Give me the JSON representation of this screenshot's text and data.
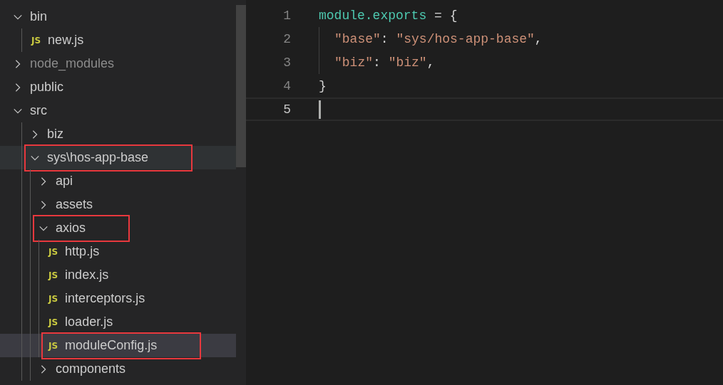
{
  "explorer": {
    "tree": [
      {
        "kind": "folder",
        "label": "bin",
        "expanded": true,
        "dimmed": false,
        "selected": false,
        "hovered": false,
        "highlighted": false,
        "children": [
          {
            "kind": "file",
            "icon": "JS",
            "label": "new.js",
            "dimmed": false,
            "selected": false,
            "hovered": false,
            "highlighted": false
          }
        ]
      },
      {
        "kind": "folder",
        "label": "node_modules",
        "expanded": false,
        "dimmed": true,
        "selected": false,
        "hovered": false,
        "highlighted": false
      },
      {
        "kind": "folder",
        "label": "public",
        "expanded": false,
        "dimmed": false,
        "selected": false,
        "hovered": false,
        "highlighted": false
      },
      {
        "kind": "folder",
        "label": "src",
        "expanded": true,
        "dimmed": false,
        "selected": false,
        "hovered": false,
        "highlighted": false,
        "children": [
          {
            "kind": "folder",
            "label": "biz",
            "expanded": false,
            "dimmed": false,
            "selected": false,
            "hovered": false,
            "highlighted": false
          },
          {
            "kind": "folder",
            "label": "sys\\hos-app-base",
            "expanded": true,
            "dimmed": false,
            "selected": false,
            "hovered": true,
            "highlighted": true,
            "children": [
              {
                "kind": "folder",
                "label": "api",
                "expanded": false,
                "dimmed": false,
                "selected": false,
                "hovered": false,
                "highlighted": false
              },
              {
                "kind": "folder",
                "label": "assets",
                "expanded": false,
                "dimmed": false,
                "selected": false,
                "hovered": false,
                "highlighted": false
              },
              {
                "kind": "folder",
                "label": "axios",
                "expanded": true,
                "dimmed": false,
                "selected": false,
                "hovered": false,
                "highlighted": true,
                "children": [
                  {
                    "kind": "file",
                    "icon": "JS",
                    "label": "http.js",
                    "dimmed": false,
                    "selected": false,
                    "hovered": false,
                    "highlighted": false
                  },
                  {
                    "kind": "file",
                    "icon": "JS",
                    "label": "index.js",
                    "dimmed": false,
                    "selected": false,
                    "hovered": false,
                    "highlighted": false
                  },
                  {
                    "kind": "file",
                    "icon": "JS",
                    "label": "interceptors.js",
                    "dimmed": false,
                    "selected": false,
                    "hovered": false,
                    "highlighted": false
                  },
                  {
                    "kind": "file",
                    "icon": "JS",
                    "label": "loader.js",
                    "dimmed": false,
                    "selected": false,
                    "hovered": false,
                    "highlighted": false
                  },
                  {
                    "kind": "file",
                    "icon": "JS",
                    "label": "moduleConfig.js",
                    "dimmed": false,
                    "selected": true,
                    "hovered": false,
                    "highlighted": true
                  }
                ]
              },
              {
                "kind": "folder",
                "label": "components",
                "expanded": false,
                "dimmed": false,
                "selected": false,
                "hovered": false,
                "highlighted": false
              }
            ]
          }
        ]
      }
    ]
  },
  "editor": {
    "lines": [
      {
        "number": "1",
        "current": false,
        "indented": false,
        "tokens": [
          {
            "kind": "type",
            "text": "module.exports"
          },
          {
            "kind": "plain",
            "text": " = {"
          }
        ]
      },
      {
        "number": "2",
        "current": false,
        "indented": true,
        "tokens": [
          {
            "kind": "string",
            "text": "\"base\""
          },
          {
            "kind": "plain",
            "text": ": "
          },
          {
            "kind": "string",
            "text": "\"sys/hos-app-base\""
          },
          {
            "kind": "plain",
            "text": ","
          }
        ]
      },
      {
        "number": "3",
        "current": false,
        "indented": true,
        "tokens": [
          {
            "kind": "string",
            "text": "\"biz\""
          },
          {
            "kind": "plain",
            "text": ": "
          },
          {
            "kind": "string",
            "text": "\"biz\""
          },
          {
            "kind": "plain",
            "text": ","
          }
        ]
      },
      {
        "number": "4",
        "current": false,
        "indented": false,
        "tokens": [
          {
            "kind": "plain",
            "text": "}"
          }
        ]
      },
      {
        "number": "5",
        "current": true,
        "indented": false
      }
    ]
  }
}
